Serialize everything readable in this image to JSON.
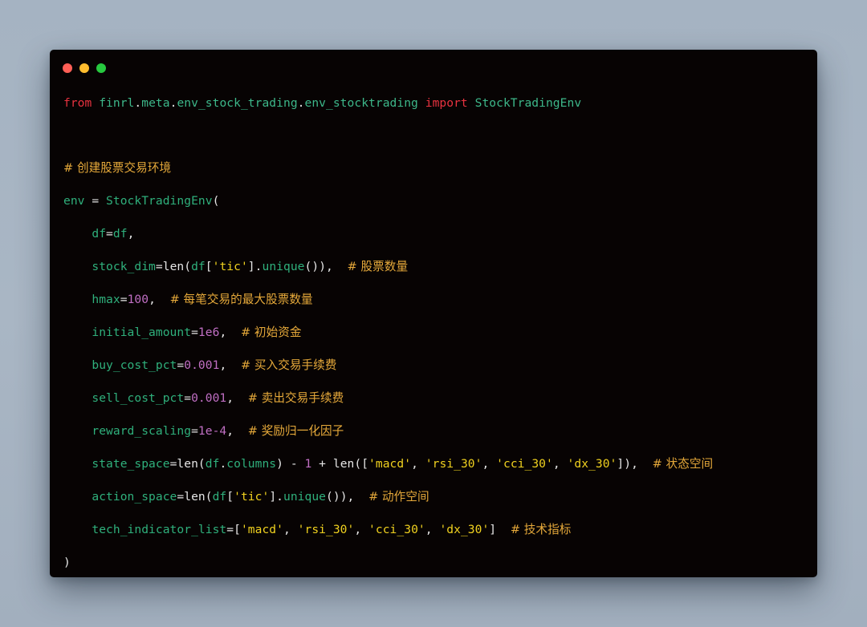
{
  "window": {
    "controls": [
      {
        "name": "close",
        "color": "#ff5f56"
      },
      {
        "name": "minimize",
        "color": "#ffbd2e"
      },
      {
        "name": "maximize",
        "color": "#27c93f"
      }
    ]
  },
  "code": {
    "lines": [
      {
        "tokens": [
          {
            "t": "from",
            "c": "kw"
          },
          {
            "t": " ",
            "c": "pn"
          },
          {
            "t": "finrl",
            "c": "mod"
          },
          {
            "t": ".",
            "c": "pn"
          },
          {
            "t": "meta",
            "c": "mod"
          },
          {
            "t": ".",
            "c": "pn"
          },
          {
            "t": "env_stock_trading",
            "c": "mod"
          },
          {
            "t": ".",
            "c": "pn"
          },
          {
            "t": "env_stocktrading",
            "c": "mod"
          },
          {
            "t": " ",
            "c": "pn"
          },
          {
            "t": "import",
            "c": "kw"
          },
          {
            "t": " ",
            "c": "pn"
          },
          {
            "t": "StockTradingEnv",
            "c": "mod"
          }
        ]
      },
      {
        "tokens": [
          {
            "t": "# 创建股票交易环境",
            "c": "cm"
          }
        ]
      },
      {
        "tokens": [
          {
            "t": "env",
            "c": "id"
          },
          {
            "t": " = ",
            "c": "pn"
          },
          {
            "t": "StockTradingEnv",
            "c": "id"
          },
          {
            "t": "(",
            "c": "pn"
          }
        ]
      },
      {
        "tokens": [
          {
            "t": "    ",
            "c": "pn"
          },
          {
            "t": "df",
            "c": "id"
          },
          {
            "t": "=",
            "c": "pn"
          },
          {
            "t": "df",
            "c": "id"
          },
          {
            "t": ",",
            "c": "pn"
          }
        ]
      },
      {
        "tokens": [
          {
            "t": "    ",
            "c": "pn"
          },
          {
            "t": "stock_dim",
            "c": "id"
          },
          {
            "t": "=len(",
            "c": "pn"
          },
          {
            "t": "df",
            "c": "id"
          },
          {
            "t": "[",
            "c": "pn"
          },
          {
            "t": "'tic'",
            "c": "str"
          },
          {
            "t": "].",
            "c": "pn"
          },
          {
            "t": "unique",
            "c": "id"
          },
          {
            "t": "()),  ",
            "c": "pn"
          },
          {
            "t": "# 股票数量",
            "c": "cm"
          }
        ]
      },
      {
        "tokens": [
          {
            "t": "    ",
            "c": "pn"
          },
          {
            "t": "hmax",
            "c": "id"
          },
          {
            "t": "=",
            "c": "pn"
          },
          {
            "t": "100",
            "c": "num"
          },
          {
            "t": ",  ",
            "c": "pn"
          },
          {
            "t": "# 每笔交易的最大股票数量",
            "c": "cm"
          }
        ]
      },
      {
        "tokens": [
          {
            "t": "    ",
            "c": "pn"
          },
          {
            "t": "initial_amount",
            "c": "id"
          },
          {
            "t": "=",
            "c": "pn"
          },
          {
            "t": "1e6",
            "c": "num"
          },
          {
            "t": ",  ",
            "c": "pn"
          },
          {
            "t": "# 初始资金",
            "c": "cm"
          }
        ]
      },
      {
        "tokens": [
          {
            "t": "    ",
            "c": "pn"
          },
          {
            "t": "buy_cost_pct",
            "c": "id"
          },
          {
            "t": "=",
            "c": "pn"
          },
          {
            "t": "0.001",
            "c": "num"
          },
          {
            "t": ",  ",
            "c": "pn"
          },
          {
            "t": "# 买入交易手续费",
            "c": "cm"
          }
        ]
      },
      {
        "tokens": [
          {
            "t": "    ",
            "c": "pn"
          },
          {
            "t": "sell_cost_pct",
            "c": "id"
          },
          {
            "t": "=",
            "c": "pn"
          },
          {
            "t": "0.001",
            "c": "num"
          },
          {
            "t": ",  ",
            "c": "pn"
          },
          {
            "t": "# 卖出交易手续费",
            "c": "cm"
          }
        ]
      },
      {
        "tokens": [
          {
            "t": "    ",
            "c": "pn"
          },
          {
            "t": "reward_scaling",
            "c": "id"
          },
          {
            "t": "=",
            "c": "pn"
          },
          {
            "t": "1e-4",
            "c": "num"
          },
          {
            "t": ",  ",
            "c": "pn"
          },
          {
            "t": "# 奖励归一化因子",
            "c": "cm"
          }
        ]
      },
      {
        "tokens": [
          {
            "t": "    ",
            "c": "pn"
          },
          {
            "t": "state_space",
            "c": "id"
          },
          {
            "t": "=len(",
            "c": "pn"
          },
          {
            "t": "df",
            "c": "id"
          },
          {
            "t": ".",
            "c": "pn"
          },
          {
            "t": "columns",
            "c": "id"
          },
          {
            "t": ") - ",
            "c": "pn"
          },
          {
            "t": "1",
            "c": "num"
          },
          {
            "t": " + len([",
            "c": "pn"
          },
          {
            "t": "'macd'",
            "c": "str"
          },
          {
            "t": ", ",
            "c": "pn"
          },
          {
            "t": "'rsi_30'",
            "c": "str"
          },
          {
            "t": ", ",
            "c": "pn"
          },
          {
            "t": "'cci_30'",
            "c": "str"
          },
          {
            "t": ", ",
            "c": "pn"
          },
          {
            "t": "'dx_30'",
            "c": "str"
          },
          {
            "t": "]),  ",
            "c": "pn"
          },
          {
            "t": "# 状态空间",
            "c": "cm"
          }
        ]
      },
      {
        "tokens": [
          {
            "t": "    ",
            "c": "pn"
          },
          {
            "t": "action_space",
            "c": "id"
          },
          {
            "t": "=len(",
            "c": "pn"
          },
          {
            "t": "df",
            "c": "id"
          },
          {
            "t": "[",
            "c": "pn"
          },
          {
            "t": "'tic'",
            "c": "str"
          },
          {
            "t": "].",
            "c": "pn"
          },
          {
            "t": "unique",
            "c": "id"
          },
          {
            "t": "()),  ",
            "c": "pn"
          },
          {
            "t": "# 动作空间",
            "c": "cm"
          }
        ]
      },
      {
        "tokens": [
          {
            "t": "    ",
            "c": "pn"
          },
          {
            "t": "tech_indicator_list",
            "c": "id"
          },
          {
            "t": "=[",
            "c": "pn"
          },
          {
            "t": "'macd'",
            "c": "str"
          },
          {
            "t": ", ",
            "c": "pn"
          },
          {
            "t": "'rsi_30'",
            "c": "str"
          },
          {
            "t": ", ",
            "c": "pn"
          },
          {
            "t": "'cci_30'",
            "c": "str"
          },
          {
            "t": ", ",
            "c": "pn"
          },
          {
            "t": "'dx_30'",
            "c": "str"
          },
          {
            "t": "]  ",
            "c": "pn"
          },
          {
            "t": "# 技术指标",
            "c": "cm"
          }
        ]
      },
      {
        "tokens": [
          {
            "t": ")",
            "c": "pn"
          }
        ]
      }
    ]
  }
}
